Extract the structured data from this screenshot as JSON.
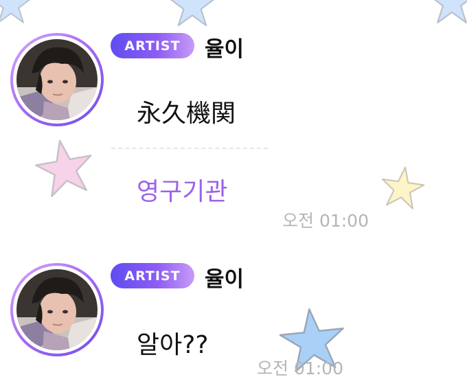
{
  "messages": [
    {
      "role_badge": "ARTIST",
      "author": "율이",
      "text": "永久機関",
      "translation": "영구기관",
      "time": "오전 01:00"
    },
    {
      "role_badge": "ARTIST",
      "author": "율이",
      "text": "알아??",
      "time": "오전 01:00"
    }
  ],
  "colors": {
    "badge_gradient": [
      "#5f4df0",
      "#c79af7"
    ],
    "avatar_ring": "#a368f2",
    "translation_text": "#9c62e8",
    "timestamp_text": "#b5b5b5"
  },
  "icons": [
    "star-blue",
    "star-pink",
    "star-yellow"
  ]
}
